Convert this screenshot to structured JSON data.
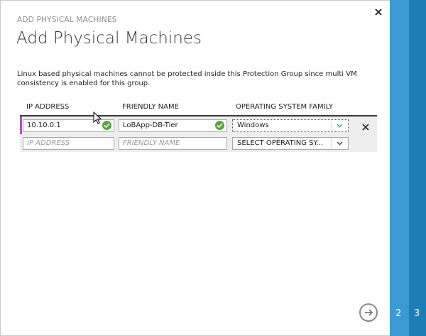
{
  "dialog": {
    "kicker": "ADD PHYSICAL MACHINES",
    "title": "Add Physical Machines",
    "note": "Linux based physical machines cannot be protected inside this Protection Group since multi VM consistency is enabled for this group."
  },
  "table": {
    "columns": [
      "IP ADDRESS",
      "FRIENDLY NAME",
      "OPERATING SYSTEM FAMILY"
    ],
    "rows": [
      {
        "ip": "10.10.0.1",
        "friendly_name": "LoBApp-DB-Tier",
        "os_family": "Windows",
        "valid": true
      },
      {
        "ip_placeholder": "IP ADDRESS",
        "friendly_name_placeholder": "FRIENDLY NAME",
        "os_family_placeholder": "SELECT OPERATING SY..."
      }
    ]
  },
  "wizard": {
    "steps": [
      "2",
      "3"
    ]
  },
  "colors": {
    "accent_marker": "#b54ec4",
    "valid_check": "#56a63c",
    "stripe_light": "#3a9ad1",
    "stripe_dark": "#1f7db5"
  }
}
